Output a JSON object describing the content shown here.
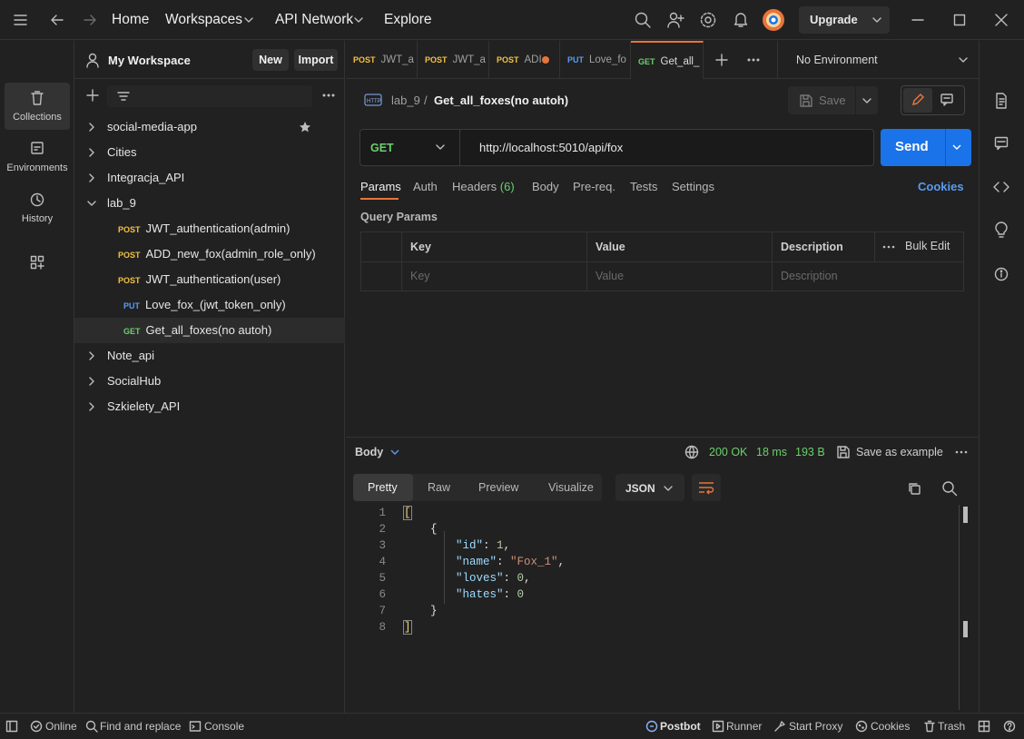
{
  "topbar": {
    "home": "Home",
    "workspaces": "Workspaces",
    "api_network": "API Network",
    "explore": "Explore",
    "upgrade": "Upgrade"
  },
  "rail": {
    "collections": "Collections",
    "environments": "Environments",
    "history": "History"
  },
  "sidebar": {
    "workspace_name": "My Workspace",
    "new_label": "New",
    "import_label": "Import",
    "collections": [
      {
        "name": "social-media-app"
      },
      {
        "name": "Cities"
      },
      {
        "name": "Integracja_API"
      },
      {
        "name": "lab_9"
      }
    ],
    "requests": [
      {
        "method": "POST",
        "name": "JWT_authentication(admin)"
      },
      {
        "method": "POST",
        "name": "ADD_new_fox(admin_role_only)"
      },
      {
        "method": "POST",
        "name": "JWT_authentication(user)"
      },
      {
        "method": "PUT",
        "name": "Love_fox_(jwt_token_only)"
      },
      {
        "method": "GET",
        "name": "Get_all_foxes(no autoh)"
      }
    ],
    "collections_after": [
      {
        "name": "Note_api"
      },
      {
        "name": "SocialHub"
      },
      {
        "name": "Szkielety_API"
      }
    ]
  },
  "tabs": [
    {
      "method": "POST",
      "label": "JWT_a"
    },
    {
      "method": "POST",
      "label": "JWT_a"
    },
    {
      "method": "POST",
      "label": "ADI"
    },
    {
      "method": "PUT",
      "label": "Love_fo"
    },
    {
      "method": "GET",
      "label": "Get_all_"
    }
  ],
  "environment": "No Environment",
  "request": {
    "breadcrumb_parent": "lab_9",
    "breadcrumb_sep": "/",
    "title": "Get_all_foxes(no autoh)",
    "save": "Save",
    "method": "GET",
    "url": "http://localhost:5010/api/fox",
    "send": "Send",
    "tabs": {
      "params": "Params",
      "auth": "Auth",
      "headers": "Headers",
      "headers_count": "(6)",
      "body": "Body",
      "prereq": "Pre-req.",
      "tests": "Tests",
      "settings": "Settings"
    },
    "cookies": "Cookies",
    "query_params_title": "Query Params",
    "table": {
      "key": "Key",
      "value": "Value",
      "description": "Description",
      "bulk_edit": "Bulk Edit",
      "key_ph": "Key",
      "value_ph": "Value",
      "description_ph": "Description"
    }
  },
  "response": {
    "body_label": "Body",
    "status": "200 OK",
    "time": "18 ms",
    "size": "193 B",
    "save_example": "Save as example",
    "views": {
      "pretty": "Pretty",
      "raw": "Raw",
      "preview": "Preview",
      "visualize": "Visualize"
    },
    "format": "JSON",
    "lines": [
      {
        "n": "1",
        "text": "["
      },
      {
        "n": "2",
        "text": "{"
      },
      {
        "n": "3",
        "key": "\"id\"",
        "value": "1",
        "tail": ","
      },
      {
        "n": "4",
        "key": "\"name\"",
        "value": "\"Fox_1\"",
        "tail": ","
      },
      {
        "n": "5",
        "key": "\"loves\"",
        "value": "0",
        "tail": ","
      },
      {
        "n": "6",
        "key": "\"hates\"",
        "value": "0",
        "tail": ""
      },
      {
        "n": "7",
        "text": "}"
      },
      {
        "n": "8",
        "text": "]"
      }
    ]
  },
  "statusbar": {
    "online": "Online",
    "find_replace": "Find and replace",
    "console": "Console",
    "postbot": "Postbot",
    "runner": "Runner",
    "start_proxy": "Start Proxy",
    "cookies": "Cookies",
    "trash": "Trash"
  },
  "colors": {
    "accent_orange": "#e8743b",
    "send_blue": "#1a73e8",
    "post": "#f5c242",
    "put": "#5b9bf0",
    "get": "#6bcf6b",
    "status_ok": "#6bcf6b"
  }
}
